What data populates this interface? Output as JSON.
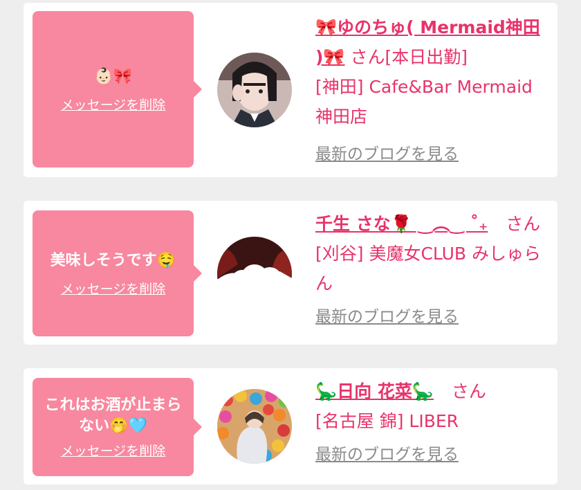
{
  "colors": {
    "background": "#eeeeee",
    "card": "#ffffff",
    "bubble": "#f7889f",
    "accent": "#e7336a",
    "link_gray": "#8a8a8a"
  },
  "items": [
    {
      "message": "👶🏻🎀",
      "delete_label": "メッセージを削除",
      "cast_name": "🎀ゆのちゅ( Mermaid神田 )🎀",
      "honorific": "さん",
      "status": "[本日出勤]",
      "shop": "[神田] Cafe&Bar Mermaid 神田店",
      "blog_link": "最新のブログを見る"
    },
    {
      "message": "美味しそうです🤤",
      "delete_label": "メッセージを削除",
      "cast_name": "千生 さな🌹 ‿︵‿ ˚₊",
      "honorific": "さん",
      "status": "",
      "shop": "[刈谷] 美魔女CLUB みしゅらん",
      "blog_link": "最新のブログを見る"
    },
    {
      "message": "これはお酒が止まらない🤭🩵",
      "delete_label": "メッセージを削除",
      "cast_name": "🦕日向 花菜🦕",
      "honorific": "さん",
      "status": "",
      "shop": "[名古屋 錦] LIBER",
      "blog_link": "最新のブログを見る"
    }
  ]
}
